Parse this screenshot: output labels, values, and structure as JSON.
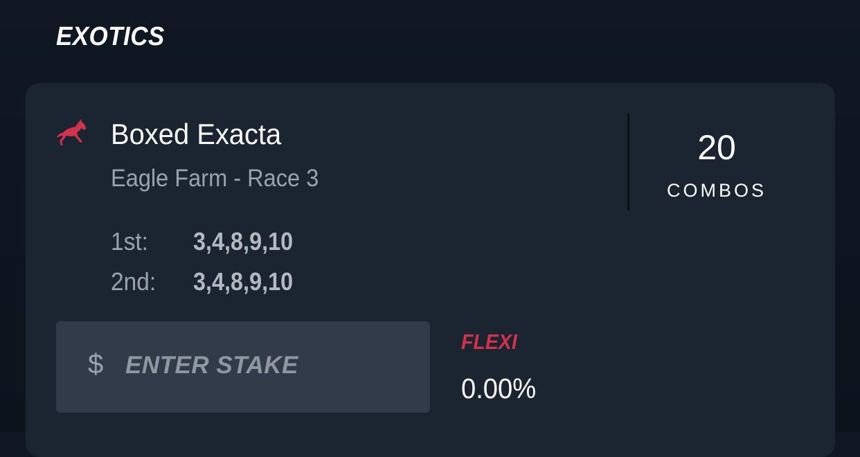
{
  "section": {
    "title": "EXOTICS"
  },
  "bet": {
    "icon": "horse-racing-icon",
    "type": "Boxed Exacta",
    "meeting": "Eagle Farm - Race 3",
    "combos": {
      "count": "20",
      "label": "COMBOS"
    },
    "selections": [
      {
        "position": "1st:",
        "runners": "3,4,8,9,10"
      },
      {
        "position": "2nd:",
        "runners": "3,4,8,9,10"
      }
    ]
  },
  "stake": {
    "currency_symbol": "$",
    "placeholder": "ENTER STAKE",
    "value": ""
  },
  "flexi": {
    "label": "FLEXI",
    "value": "0.00%"
  },
  "colors": {
    "background": "#0f1823",
    "card": "#1b2431",
    "input": "#323b49",
    "accent": "#d2324a",
    "text_primary": "#ffffff",
    "text_secondary": "#9aa3ad"
  }
}
